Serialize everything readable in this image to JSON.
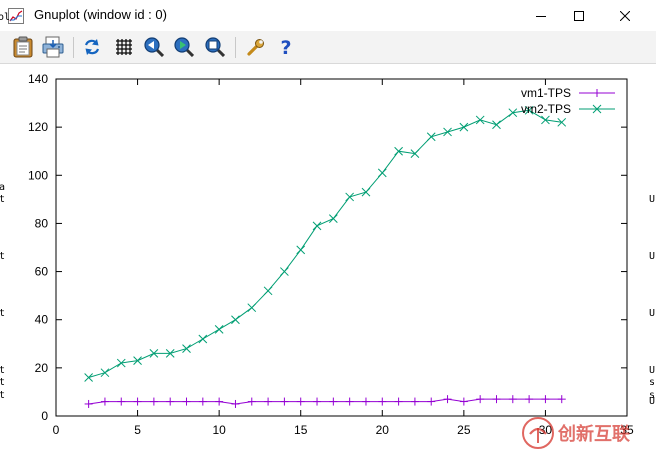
{
  "window": {
    "title": "Gnuplot (window id : 0)"
  },
  "title_bar_buttons": {
    "minimize_icon": "minimize-icon",
    "maximize_icon": "maximize-icon",
    "close_icon": "close-icon"
  },
  "toolbar": {
    "buttons": [
      {
        "name": "copy-clipboard-button",
        "icon": "clipboard-icon"
      },
      {
        "name": "print-button",
        "icon": "printer-icon"
      },
      {
        "name": "replot-button",
        "icon": "refresh-icon"
      },
      {
        "name": "grid-button",
        "icon": "grid-icon"
      },
      {
        "name": "zoom-previous-button",
        "icon": "zoom-back-icon"
      },
      {
        "name": "zoom-next-button",
        "icon": "zoom-forward-icon"
      },
      {
        "name": "autoscale-button",
        "icon": "zoom-fit-icon"
      },
      {
        "name": "options-button",
        "icon": "wrench-icon"
      },
      {
        "name": "help-button",
        "icon": "help-icon"
      }
    ]
  },
  "edge_fragments": {
    "top_left": "ol",
    "left": [
      "a",
      "t",
      "t",
      "t",
      "t",
      "t",
      "t"
    ],
    "right": [
      "U",
      "U",
      "U",
      "U",
      "s",
      "s",
      "U"
    ]
  },
  "watermark": {
    "text": "创新互联",
    "accent_color": "#d5342c"
  },
  "chart_data": {
    "type": "line",
    "title": "",
    "xlabel": "",
    "ylabel": "",
    "xlim": [
      0,
      35
    ],
    "ylim": [
      0,
      140
    ],
    "x_ticks": [
      0,
      5,
      10,
      15,
      20,
      25,
      30,
      35
    ],
    "y_ticks": [
      0,
      20,
      40,
      60,
      80,
      100,
      120,
      140
    ],
    "grid": false,
    "legend_position": "top-right",
    "series": [
      {
        "name": "vm1-TPS",
        "color": "#9400d3",
        "marker": "plus",
        "x": [
          2,
          3,
          4,
          5,
          6,
          7,
          8,
          9,
          10,
          11,
          12,
          13,
          14,
          15,
          16,
          17,
          18,
          19,
          20,
          21,
          22,
          23,
          24,
          25,
          26,
          27,
          28,
          29,
          30,
          31
        ],
        "y": [
          5,
          6,
          6,
          6,
          6,
          6,
          6,
          6,
          6,
          5,
          6,
          6,
          6,
          6,
          6,
          6,
          6,
          6,
          6,
          6,
          6,
          6,
          7,
          6,
          7,
          7,
          7,
          7,
          7,
          7
        ]
      },
      {
        "name": "vm2-TPS",
        "color": "#009e73",
        "marker": "cross",
        "x": [
          2,
          3,
          4,
          5,
          6,
          7,
          8,
          9,
          10,
          11,
          12,
          13,
          14,
          15,
          16,
          17,
          18,
          19,
          20,
          21,
          22,
          23,
          24,
          25,
          26,
          27,
          28,
          29,
          30,
          31
        ],
        "y": [
          16,
          18,
          22,
          23,
          26,
          26,
          28,
          32,
          36,
          40,
          45,
          52,
          60,
          69,
          79,
          82,
          91,
          93,
          101,
          110,
          109,
          116,
          118,
          120,
          123,
          121,
          126,
          127,
          123,
          122
        ]
      }
    ]
  }
}
